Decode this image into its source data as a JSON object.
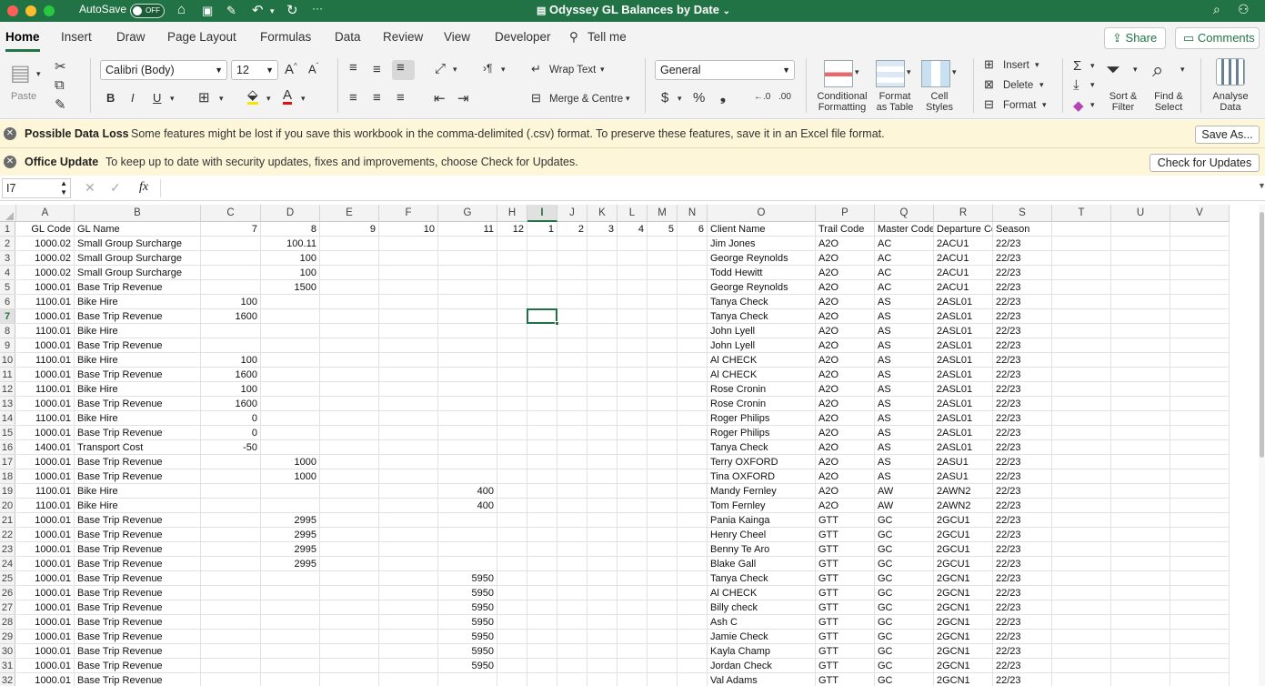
{
  "titlebar": {
    "autosave_label": "AutoSave",
    "autosave_state": "OFF",
    "more": "···",
    "doc_title": "Odyssey GL Balances by Date",
    "title_chevron": "⌄"
  },
  "tabs": [
    "Home",
    "Insert",
    "Draw",
    "Page Layout",
    "Formulas",
    "Data",
    "Review",
    "View",
    "Developer",
    "Tell me"
  ],
  "actions": {
    "share": "Share",
    "comments": "Comments"
  },
  "ribbon": {
    "paste": "Paste",
    "font_name": "Calibri (Body)",
    "font_size": "12",
    "wrap_text": "Wrap Text",
    "merge_centre": "Merge & Centre",
    "number_format": "General",
    "conditional_formatting": [
      "Conditional",
      "Formatting"
    ],
    "format_as_table": [
      "Format",
      "as Table"
    ],
    "cell_styles": [
      "Cell",
      "Styles"
    ],
    "insert": "Insert",
    "delete": "Delete",
    "format": "Format",
    "sort_filter": [
      "Sort &",
      "Filter"
    ],
    "find_select": [
      "Find &",
      "Select"
    ],
    "analyse_data": [
      "Analyse",
      "Data"
    ]
  },
  "messages": [
    {
      "title": "Possible Data Loss",
      "text": "Some features might be lost if you save this workbook in the comma-delimited (.csv) format. To preserve these features, save it in an Excel file format.",
      "button": "Save As..."
    },
    {
      "title": "Office Update",
      "text": "To keep up to date with security updates, fixes and improvements, choose Check for Updates.",
      "button": "Check for Updates"
    }
  ],
  "formula_bar": {
    "cell_ref": "I7",
    "fx": "fx",
    "value": ""
  },
  "sheet": {
    "columns": [
      "A",
      "B",
      "C",
      "D",
      "E",
      "F",
      "G",
      "H",
      "I",
      "J",
      "K",
      "L",
      "M",
      "N",
      "O",
      "P",
      "Q",
      "R",
      "S",
      "T",
      "U",
      "V"
    ],
    "selected_column": "I",
    "selected_row": 7,
    "row_numbers": [
      1,
      2,
      3,
      4,
      5,
      6,
      7,
      8,
      9,
      10,
      11,
      12,
      13,
      14,
      15,
      16,
      17,
      18,
      19,
      20,
      21,
      22,
      23,
      24,
      25,
      26,
      27,
      28,
      29,
      30,
      31,
      32
    ],
    "rows": [
      [
        "GL Code",
        "GL Name",
        "7",
        "8",
        "9",
        "10",
        "11",
        "12",
        "1",
        "2",
        "3",
        "4",
        "5",
        "6",
        "Client Name",
        "Trail Code",
        "Master Code",
        "Departure Cc",
        "Season",
        "",
        "",
        ""
      ],
      [
        "1000.02",
        "Small Group Surcharge",
        "",
        "100.11",
        "",
        "",
        "",
        "",
        "",
        "",
        "",
        "",
        "",
        "",
        "Jim Jones",
        "A2O",
        "AC",
        "2ACU1",
        "22/23",
        "",
        "",
        ""
      ],
      [
        "1000.02",
        "Small Group Surcharge",
        "",
        "100",
        "",
        "",
        "",
        "",
        "",
        "",
        "",
        "",
        "",
        "",
        "George Reynolds",
        "A2O",
        "AC",
        "2ACU1",
        "22/23",
        "",
        "",
        ""
      ],
      [
        "1000.02",
        "Small Group Surcharge",
        "",
        "100",
        "",
        "",
        "",
        "",
        "",
        "",
        "",
        "",
        "",
        "",
        "Todd Hewitt",
        "A2O",
        "AC",
        "2ACU1",
        "22/23",
        "",
        "",
        ""
      ],
      [
        "1000.01",
        "Base Trip Revenue",
        "",
        "1500",
        "",
        "",
        "",
        "",
        "",
        "",
        "",
        "",
        "",
        "",
        "George Reynolds",
        "A2O",
        "AC",
        "2ACU1",
        "22/23",
        "",
        "",
        ""
      ],
      [
        "1100.01",
        "Bike Hire",
        "100",
        "",
        "",
        "",
        "",
        "",
        "",
        "",
        "",
        "",
        "",
        "",
        "Tanya Check",
        "A2O",
        "AS",
        "2ASL01",
        "22/23",
        "",
        "",
        ""
      ],
      [
        "1000.01",
        "Base Trip Revenue",
        "1600",
        "",
        "",
        "",
        "",
        "",
        "",
        "",
        "",
        "",
        "",
        "",
        "Tanya Check",
        "A2O",
        "AS",
        "2ASL01",
        "22/23",
        "",
        "",
        ""
      ],
      [
        "1100.01",
        "Bike Hire",
        "",
        "",
        "",
        "",
        "",
        "",
        "",
        "",
        "",
        "",
        "",
        "",
        "John Lyell",
        "A2O",
        "AS",
        "2ASL01",
        "22/23",
        "",
        "",
        ""
      ],
      [
        "1000.01",
        "Base Trip Revenue",
        "",
        "",
        "",
        "",
        "",
        "",
        "",
        "",
        "",
        "",
        "",
        "",
        "John Lyell",
        "A2O",
        "AS",
        "2ASL01",
        "22/23",
        "",
        "",
        ""
      ],
      [
        "1100.01",
        "Bike Hire",
        "100",
        "",
        "",
        "",
        "",
        "",
        "",
        "",
        "",
        "",
        "",
        "",
        "Al CHECK",
        "A2O",
        "AS",
        "2ASL01",
        "22/23",
        "",
        "",
        ""
      ],
      [
        "1000.01",
        "Base Trip Revenue",
        "1600",
        "",
        "",
        "",
        "",
        "",
        "",
        "",
        "",
        "",
        "",
        "",
        "Al CHECK",
        "A2O",
        "AS",
        "2ASL01",
        "22/23",
        "",
        "",
        ""
      ],
      [
        "1100.01",
        "Bike Hire",
        "100",
        "",
        "",
        "",
        "",
        "",
        "",
        "",
        "",
        "",
        "",
        "",
        "Rose Cronin",
        "A2O",
        "AS",
        "2ASL01",
        "22/23",
        "",
        "",
        ""
      ],
      [
        "1000.01",
        "Base Trip Revenue",
        "1600",
        "",
        "",
        "",
        "",
        "",
        "",
        "",
        "",
        "",
        "",
        "",
        "Rose Cronin",
        "A2O",
        "AS",
        "2ASL01",
        "22/23",
        "",
        "",
        ""
      ],
      [
        "1100.01",
        "Bike Hire",
        "0",
        "",
        "",
        "",
        "",
        "",
        "",
        "",
        "",
        "",
        "",
        "",
        "Roger Philips",
        "A2O",
        "AS",
        "2ASL01",
        "22/23",
        "",
        "",
        ""
      ],
      [
        "1000.01",
        "Base Trip Revenue",
        "0",
        "",
        "",
        "",
        "",
        "",
        "",
        "",
        "",
        "",
        "",
        "",
        "Roger Philips",
        "A2O",
        "AS",
        "2ASL01",
        "22/23",
        "",
        "",
        ""
      ],
      [
        "1400.01",
        "Transport Cost",
        "-50",
        "",
        "",
        "",
        "",
        "",
        "",
        "",
        "",
        "",
        "",
        "",
        "Tanya Check",
        "A2O",
        "AS",
        "2ASL01",
        "22/23",
        "",
        "",
        ""
      ],
      [
        "1000.01",
        "Base Trip Revenue",
        "",
        "1000",
        "",
        "",
        "",
        "",
        "",
        "",
        "",
        "",
        "",
        "",
        "Terry OXFORD",
        "A2O",
        "AS",
        "2ASU1",
        "22/23",
        "",
        "",
        ""
      ],
      [
        "1000.01",
        "Base Trip Revenue",
        "",
        "1000",
        "",
        "",
        "",
        "",
        "",
        "",
        "",
        "",
        "",
        "",
        "Tina OXFORD",
        "A2O",
        "AS",
        "2ASU1",
        "22/23",
        "",
        "",
        ""
      ],
      [
        "1100.01",
        "Bike Hire",
        "",
        "",
        "",
        "",
        "400",
        "",
        "",
        "",
        "",
        "",
        "",
        "",
        "Mandy Fernley",
        "A2O",
        "AW",
        "2AWN2",
        "22/23",
        "",
        "",
        ""
      ],
      [
        "1100.01",
        "Bike Hire",
        "",
        "",
        "",
        "",
        "400",
        "",
        "",
        "",
        "",
        "",
        "",
        "",
        "Tom Fernley",
        "A2O",
        "AW",
        "2AWN2",
        "22/23",
        "",
        "",
        ""
      ],
      [
        "1000.01",
        "Base Trip Revenue",
        "",
        "2995",
        "",
        "",
        "",
        "",
        "",
        "",
        "",
        "",
        "",
        "",
        "Pania Kainga",
        "GTT",
        "GC",
        "2GCU1",
        "22/23",
        "",
        "",
        ""
      ],
      [
        "1000.01",
        "Base Trip Revenue",
        "",
        "2995",
        "",
        "",
        "",
        "",
        "",
        "",
        "",
        "",
        "",
        "",
        "Henry Cheel",
        "GTT",
        "GC",
        "2GCU1",
        "22/23",
        "",
        "",
        ""
      ],
      [
        "1000.01",
        "Base Trip Revenue",
        "",
        "2995",
        "",
        "",
        "",
        "",
        "",
        "",
        "",
        "",
        "",
        "",
        "Benny Te Aro",
        "GTT",
        "GC",
        "2GCU1",
        "22/23",
        "",
        "",
        ""
      ],
      [
        "1000.01",
        "Base Trip Revenue",
        "",
        "2995",
        "",
        "",
        "",
        "",
        "",
        "",
        "",
        "",
        "",
        "",
        "Blake Gall",
        "GTT",
        "GC",
        "2GCU1",
        "22/23",
        "",
        "",
        ""
      ],
      [
        "1000.01",
        "Base Trip Revenue",
        "",
        "",
        "",
        "",
        "5950",
        "",
        "",
        "",
        "",
        "",
        "",
        "",
        "Tanya Check",
        "GTT",
        "GC",
        "2GCN1",
        "22/23",
        "",
        "",
        ""
      ],
      [
        "1000.01",
        "Base Trip Revenue",
        "",
        "",
        "",
        "",
        "5950",
        "",
        "",
        "",
        "",
        "",
        "",
        "",
        "Al CHECK",
        "GTT",
        "GC",
        "2GCN1",
        "22/23",
        "",
        "",
        ""
      ],
      [
        "1000.01",
        "Base Trip Revenue",
        "",
        "",
        "",
        "",
        "5950",
        "",
        "",
        "",
        "",
        "",
        "",
        "",
        "Billy check",
        "GTT",
        "GC",
        "2GCN1",
        "22/23",
        "",
        "",
        ""
      ],
      [
        "1000.01",
        "Base Trip Revenue",
        "",
        "",
        "",
        "",
        "5950",
        "",
        "",
        "",
        "",
        "",
        "",
        "",
        "Ash C",
        "GTT",
        "GC",
        "2GCN1",
        "22/23",
        "",
        "",
        ""
      ],
      [
        "1000.01",
        "Base Trip Revenue",
        "",
        "",
        "",
        "",
        "5950",
        "",
        "",
        "",
        "",
        "",
        "",
        "",
        "Jamie Check",
        "GTT",
        "GC",
        "2GCN1",
        "22/23",
        "",
        "",
        ""
      ],
      [
        "1000.01",
        "Base Trip Revenue",
        "",
        "",
        "",
        "",
        "5950",
        "",
        "",
        "",
        "",
        "",
        "",
        "",
        "Kayla Champ",
        "GTT",
        "GC",
        "2GCN1",
        "22/23",
        "",
        "",
        ""
      ],
      [
        "1000.01",
        "Base Trip Revenue",
        "",
        "",
        "",
        "",
        "5950",
        "",
        "",
        "",
        "",
        "",
        "",
        "",
        "Jordan Check",
        "GTT",
        "GC",
        "2GCN1",
        "22/23",
        "",
        "",
        ""
      ],
      [
        "1000.01",
        "Base Trip Revenue",
        "",
        "",
        "",
        "",
        "",
        "",
        "",
        "",
        "",
        "",
        "",
        "",
        "Val Adams",
        "GTT",
        "GC",
        "2GCN1",
        "22/23",
        "",
        "",
        ""
      ]
    ]
  },
  "colors": {
    "accent": "#217346",
    "banner": "#fdf6d8"
  }
}
